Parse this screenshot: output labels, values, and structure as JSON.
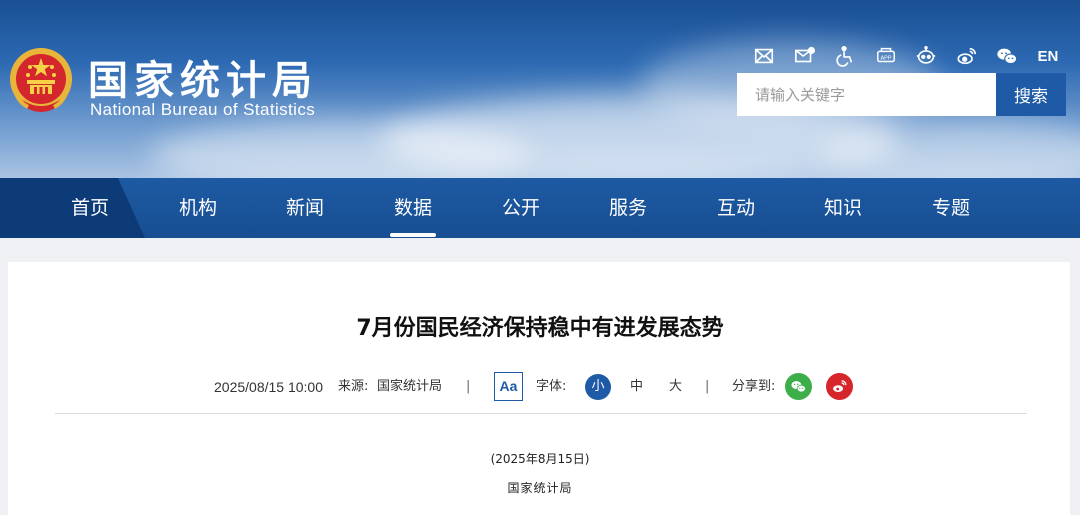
{
  "header": {
    "site_title_cn": "国家统计局",
    "site_title_en": "National Bureau of Statistics",
    "tools": [
      {
        "icon": "mail-icon"
      },
      {
        "icon": "mail-settings-icon"
      },
      {
        "icon": "accessibility-icon"
      },
      {
        "icon": "app-icon"
      },
      {
        "icon": "robot-icon"
      },
      {
        "icon": "weibo-icon"
      },
      {
        "icon": "wechat-icon"
      }
    ],
    "lang_label": "EN",
    "search": {
      "placeholder": "请输入关键字",
      "button_label": "搜索"
    }
  },
  "nav": {
    "items": [
      "首页",
      "机构",
      "新闻",
      "数据",
      "公开",
      "服务",
      "互动",
      "知识",
      "专题"
    ],
    "active_index": 3
  },
  "article": {
    "title": "7月份国民经济保持稳中有进发展态势",
    "date": "2025/08/15 10:00",
    "source_label": "来源:",
    "source": "国家统计局",
    "separator": "|",
    "aa_label": "Aa",
    "font_label": "字体:",
    "font_small": "小",
    "font_medium": "中",
    "font_large": "大",
    "share_label": "分享到:",
    "body_date": "(2025年8月15日)",
    "body_source": "国家统计局"
  },
  "colors": {
    "nav_blue": "#1d5aa3",
    "nav_home": "#0c3b78",
    "search_button": "#1f5aa6",
    "wechat_green": "#3dae4a",
    "weibo_red": "#d6262c"
  }
}
